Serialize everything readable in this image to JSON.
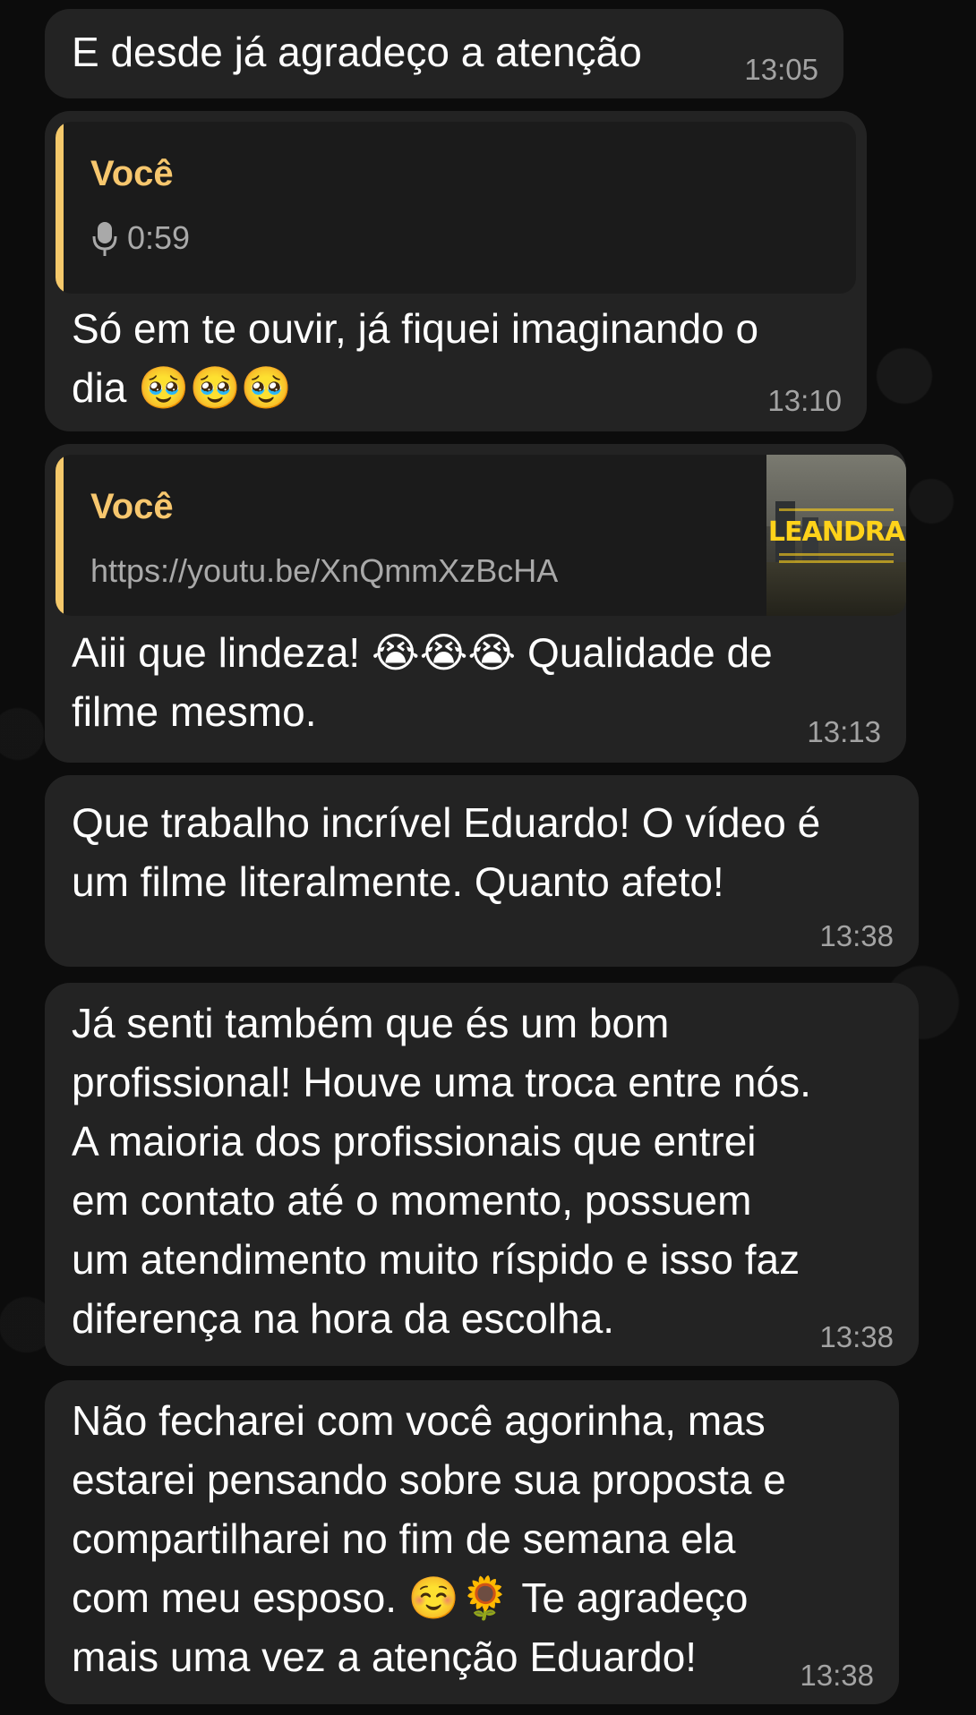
{
  "messages": [
    {
      "text": "E desde já agradeço a atenção",
      "time": "13:05"
    },
    {
      "reply": {
        "author": "Você",
        "icon": "mic-icon",
        "content": "0:59"
      },
      "text": "Só em te ouvir, já fiquei imaginando o\ndia 🥹🥹🥹",
      "time": "13:10"
    },
    {
      "reply": {
        "author": "Você",
        "content": "https://youtu.be/XnQmmXzBcHA",
        "thumbnail_title": "LEANDRA"
      },
      "text": "Aiii que lindeza! 😭😭😭 Qualidade de\nfilme mesmo.",
      "time": "13:13"
    },
    {
      "text": "Que trabalho incrível Eduardo! O vídeo é\num filme literalmente. Quanto afeto!",
      "time": "13:38"
    },
    {
      "text": "Já senti também que és um bom\nprofissional! Houve uma troca entre nós.\nA maioria dos profissionais que entrei\nem contato até o momento, possuem\num atendimento muito ríspido e isso faz\ndiferença na hora da escolha.",
      "time": "13:38"
    },
    {
      "text": "Não fecharei com você agorinha, mas\nestarei pensando sobre sua proposta e\ncompartilharei no fim de semana ela\ncom meu esposo. ☺️🌻 Te agradeço\nmais uma vez a atenção Eduardo!",
      "time": "13:38"
    }
  ],
  "colors": {
    "bubble": "#232323",
    "reply_accent": "#f5c96b",
    "reply_name": "#f7c76e",
    "timestamp": "#a3a3a3",
    "thumbnail_title": "#ffd21a"
  }
}
